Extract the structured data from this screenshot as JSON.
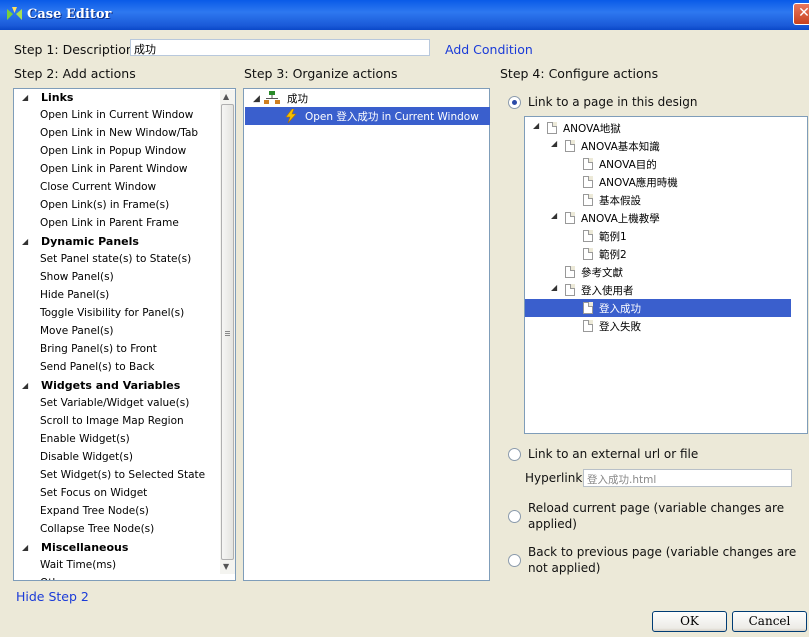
{
  "window": {
    "title": "Case Editor",
    "close": "✕"
  },
  "step1": {
    "label": "Step 1: Description",
    "value": "成功",
    "add_condition": "Add Condition"
  },
  "step2": {
    "label": "Step 2: Add actions",
    "groups": [
      {
        "name": "Links",
        "items": [
          "Open Link in Current Window",
          "Open Link in New Window/Tab",
          "Open Link in Popup Window",
          "Open Link in Parent Window",
          "Close Current Window",
          "Open Link(s) in Frame(s)",
          "Open Link in Parent Frame"
        ]
      },
      {
        "name": "Dynamic Panels",
        "items": [
          "Set Panel state(s) to State(s)",
          "Show Panel(s)",
          "Hide Panel(s)",
          "Toggle Visibility for Panel(s)",
          "Move Panel(s)",
          "Bring Panel(s) to Front",
          "Send Panel(s) to Back"
        ]
      },
      {
        "name": "Widgets and Variables",
        "items": [
          "Set Variable/Widget value(s)",
          "Scroll to Image Map Region",
          "Enable Widget(s)",
          "Disable Widget(s)",
          "Set Widget(s) to Selected State",
          "Set Focus on Widget",
          "Expand Tree Node(s)",
          "Collapse Tree Node(s)"
        ]
      },
      {
        "name": "Miscellaneous",
        "items": [
          "Wait Time(ms)",
          "Other"
        ]
      }
    ]
  },
  "step3": {
    "label": "Step 3: Organize actions",
    "case_name": "成功",
    "action": "Open 登入成功 in Current Window"
  },
  "step4": {
    "label": "Step 4: Configure actions",
    "opt_page": "Link to a page in this design",
    "tree": [
      {
        "text": "ANOVA地獄",
        "level": 0,
        "expanded": true
      },
      {
        "text": "ANOVA基本知識",
        "level": 1,
        "expanded": true
      },
      {
        "text": "ANOVA目的",
        "level": 2
      },
      {
        "text": "ANOVA應用時機",
        "level": 2
      },
      {
        "text": "基本假設",
        "level": 2
      },
      {
        "text": "ANOVA上機教學",
        "level": 1,
        "expanded": true
      },
      {
        "text": "範例1",
        "level": 2
      },
      {
        "text": "範例2",
        "level": 2
      },
      {
        "text": "參考文獻",
        "level": 1
      },
      {
        "text": "登入使用者",
        "level": 1,
        "expanded": true
      },
      {
        "text": "登入成功",
        "level": 2,
        "selected": true
      },
      {
        "text": "登入失敗",
        "level": 2
      }
    ],
    "opt_url": "Link to an external url or file",
    "hyperlink_label": "Hyperlink",
    "hyperlink_value": "登入成功.html",
    "opt_reload_1": "Reload current page (variable changes are",
    "opt_reload_2": "applied)",
    "opt_back_1": "Back to previous page (variable changes are",
    "opt_back_2": "not applied)"
  },
  "footer": {
    "hide_step2": "Hide Step 2",
    "ok": "OK",
    "cancel": "Cancel"
  }
}
